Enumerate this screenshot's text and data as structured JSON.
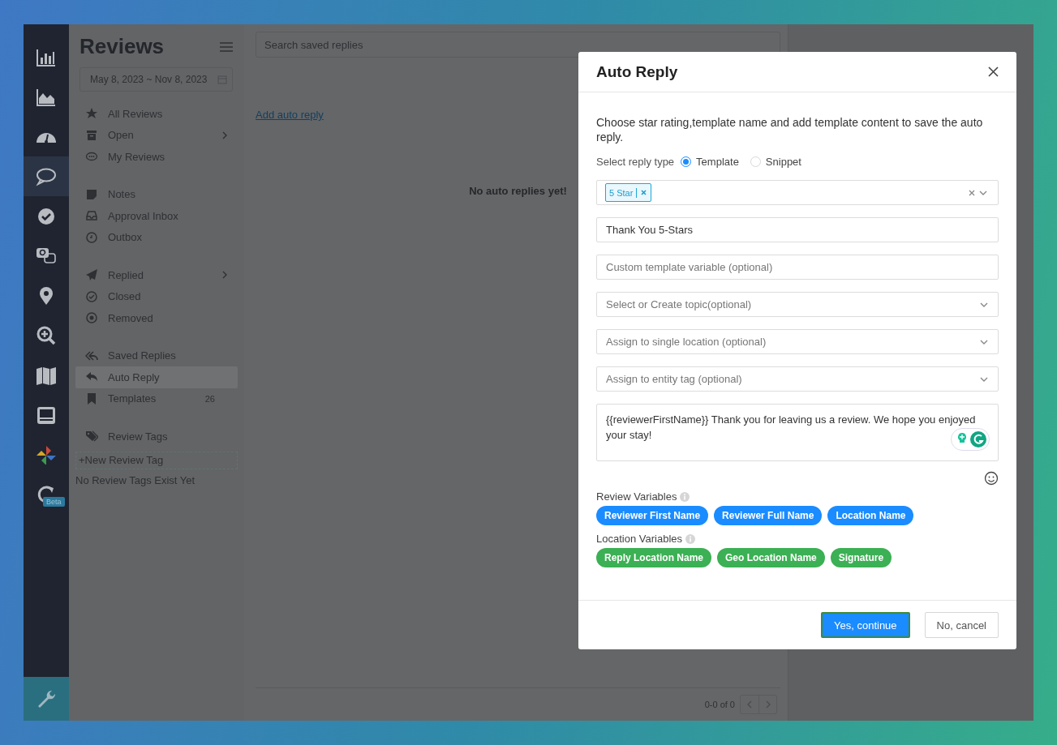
{
  "rail": {
    "items": [
      {
        "kind": "bars",
        "selected": false
      },
      {
        "kind": "area",
        "selected": false
      },
      {
        "kind": "gauge",
        "selected": false
      },
      {
        "kind": "chat",
        "selected": true
      },
      {
        "kind": "check",
        "selected": false
      },
      {
        "kind": "qa",
        "selected": false
      },
      {
        "kind": "pin",
        "selected": false
      },
      {
        "kind": "zoom",
        "selected": false
      },
      {
        "kind": "map",
        "selected": false
      },
      {
        "kind": "panel",
        "selected": false
      },
      {
        "kind": "pinwheel",
        "selected": false
      },
      {
        "kind": "loop",
        "selected": false,
        "badge": "Beta"
      }
    ],
    "settings": {
      "kind": "wrench"
    }
  },
  "sidebar": {
    "title": "Reviews",
    "date_range": "May 8, 2023 ~ Nov 8, 2023",
    "groups": [
      {
        "items": [
          {
            "kind": "star",
            "label": "All Reviews",
            "selected": false,
            "submenu": false
          },
          {
            "kind": "archive",
            "label": "Open",
            "selected": false,
            "submenu": true
          },
          {
            "kind": "comment",
            "label": "My Reviews",
            "selected": false,
            "submenu": false
          }
        ]
      },
      {
        "items": [
          {
            "kind": "note",
            "label": "Notes",
            "selected": false,
            "submenu": false
          },
          {
            "kind": "inbox",
            "label": "Approval Inbox",
            "selected": false,
            "submenu": false
          },
          {
            "kind": "clock",
            "label": "Outbox",
            "selected": false,
            "submenu": false
          }
        ]
      },
      {
        "items": [
          {
            "kind": "send",
            "label": "Replied",
            "selected": false,
            "submenu": true
          },
          {
            "kind": "check",
            "label": "Closed",
            "selected": false,
            "submenu": false
          },
          {
            "kind": "xcircle",
            "label": "Removed",
            "selected": false,
            "submenu": false
          }
        ]
      },
      {
        "items": [
          {
            "kind": "replyall",
            "label": "Saved Replies",
            "selected": false,
            "submenu": false
          },
          {
            "kind": "reply",
            "label": "Auto Reply",
            "selected": true,
            "submenu": false
          },
          {
            "kind": "bookmark",
            "label": "Templates",
            "selected": false,
            "submenu": false,
            "count": "26"
          }
        ]
      }
    ],
    "tags": {
      "label": "Review Tags",
      "new_button": "+New Review Tag",
      "empty": "No Review Tags Exist Yet"
    }
  },
  "main": {
    "search": {
      "placeholder": "Search saved replies"
    },
    "add_link": "Add auto reply",
    "empty": "No auto replies yet!",
    "pagination": "0-0 of 0"
  },
  "modal": {
    "title": "Auto Reply",
    "description": "Choose star rating,template name and add template content to save the auto reply.",
    "reply_type": {
      "label": "Select reply type",
      "options": [
        {
          "label": "Template",
          "selected": true
        },
        {
          "label": "Snippet",
          "selected": false
        }
      ]
    },
    "rating": {
      "tags": [
        {
          "label": "5 Star"
        }
      ]
    },
    "fields": [
      {
        "kind": "input",
        "value": "Thank You 5-Stars"
      },
      {
        "kind": "input",
        "placeholder": "Custom template variable (optional)"
      },
      {
        "kind": "select",
        "placeholder": "Select or Create topic(optional)"
      },
      {
        "kind": "select",
        "placeholder": "Assign to single location (optional)"
      },
      {
        "kind": "select",
        "placeholder": "Assign to entity tag (optional)"
      }
    ],
    "content": "{{reviewerFirstName}} Thank you for leaving us a review. We hope you enjoyed your stay!",
    "variable_groups": [
      {
        "label": "Review Variables",
        "color": "#1a8cff",
        "chips": [
          "Reviewer First Name",
          "Reviewer Full Name",
          "Location Name"
        ]
      },
      {
        "label": "Location Variables",
        "color": "#3cb054",
        "chips": [
          "Reply Location Name",
          "Geo Location Name",
          "Signature"
        ]
      }
    ],
    "buttons": [
      {
        "kind": "primary",
        "label": "Yes, continue"
      },
      {
        "kind": "secondary",
        "label": "No, cancel"
      }
    ]
  }
}
